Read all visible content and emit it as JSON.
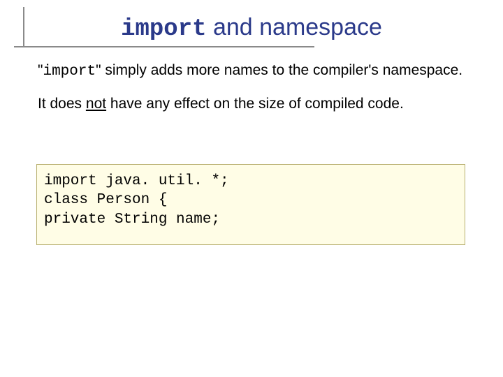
{
  "title": {
    "mono": "import",
    "rest": " and namespace"
  },
  "body": {
    "p1": {
      "quote_open": "\"",
      "mono": "import",
      "rest": "\" simply adds more names to the compiler's namespace."
    },
    "p2": {
      "pre": "It does ",
      "ul": "not",
      "post": " have any effect on the size of compiled code."
    }
  },
  "code": {
    "line1": "import java. util. *;",
    "line2": "class Person {",
    "line3": "private String name;"
  }
}
